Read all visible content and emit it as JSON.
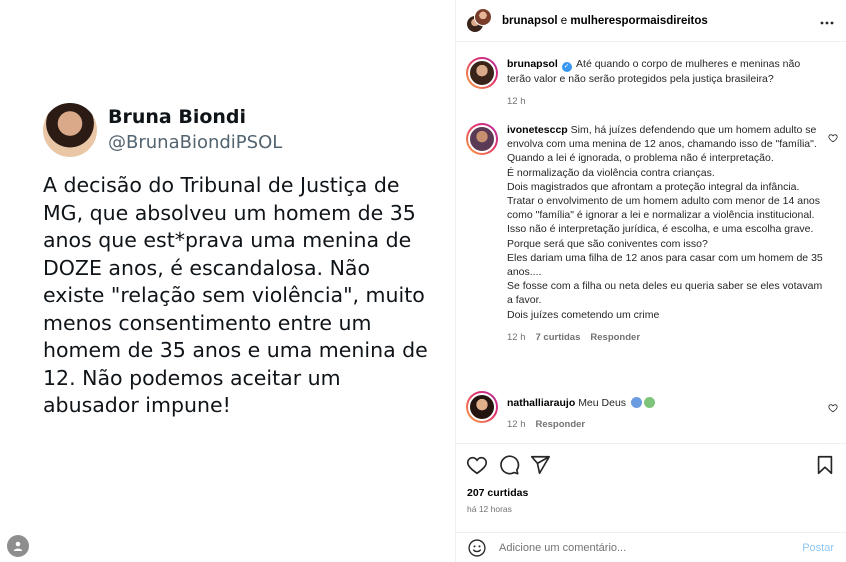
{
  "tweet": {
    "name": "Bruna Biondi",
    "handle": "@BrunaBiondiPSOL",
    "text": "A decisão do Tribunal de Justiça de MG, que absolveu um homem de 35 anos que est*prava uma menina de DOZE anos, é escandalosa. Não existe \"relação sem violência\", muito menos consentimento entre um homem de 35 anos e uma menina de 12. Não podemos aceitar um abusador impune!"
  },
  "header": {
    "user1": "brunapsol",
    "separator": " e ",
    "user2": "mulherespormaisdireitos",
    "more_icon": "more-horizontal-icon"
  },
  "caption": {
    "user": "brunapsol",
    "text": "Até quando o corpo de mulheres e meninas não terão valor e não serão protegidos pela justiça brasileira?",
    "time": "12 h"
  },
  "comments": [
    {
      "user": "ivonetesccp",
      "text": "Sim, há juízes defendendo que um homem adulto se envolva com uma menina de 12 anos, chamando isso de \"família\".\nQuando a lei é ignorada, o problema não é interpretação.\nÉ normalização da violência contra crianças.\nDois magistrados que afrontam a proteção integral da infância.\nTratar o envolvimento de um homem adulto com menor de 14 anos como \"família\" é ignorar a lei e normalizar a violência institucional. Isso não é interpretação jurídica, é escolha, e uma escolha grave.\nPorque será que são coniventes com isso?\nEles dariam uma filha de 12 anos para casar com um homem de 35 anos....\nSe fosse com a filha ou neta deles eu queria saber se eles votavam a favor.\nDois juízes cometendo um crime",
      "time": "12 h",
      "likes": "7 curtidas",
      "reply": "Responder"
    },
    {
      "user": "nathalliaraujo",
      "text": "Meu Deus",
      "time": "12 h",
      "reply": "Responder"
    }
  ],
  "actions": {
    "likes": "207 curtidas",
    "time_ago": "há 12 horas",
    "placeholder": "Adicione um comentário...",
    "post_label": "Postar"
  },
  "colors": {
    "accent": "#3897f0",
    "post_button": "#8fc7f4",
    "muted": "#737373",
    "ring_start": "#f9a43c",
    "ring_end": "#b12da6"
  }
}
